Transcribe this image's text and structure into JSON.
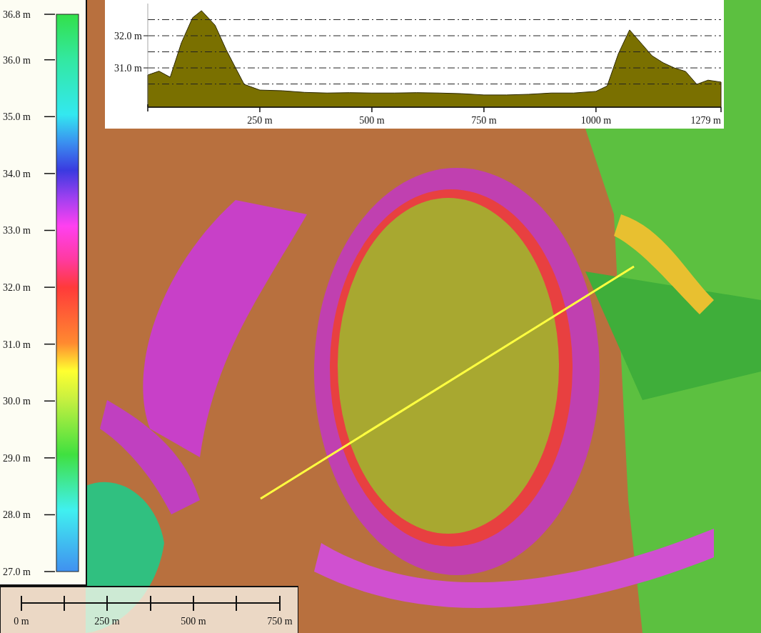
{
  "legend": {
    "labels": [
      "36.8 m",
      "36.0 m",
      "35.0 m",
      "34.0 m",
      "33.0 m",
      "32.0 m",
      "31.0 m",
      "30.0 m",
      "29.0 m",
      "28.0 m",
      "27.0 m"
    ]
  },
  "profile": {
    "chart_data": {
      "type": "area",
      "x": [
        0,
        25,
        50,
        75,
        100,
        120,
        150,
        175,
        200,
        215,
        250,
        300,
        350,
        400,
        450,
        500,
        550,
        600,
        650,
        700,
        750,
        800,
        850,
        900,
        950,
        1000,
        1025,
        1050,
        1075,
        1100,
        1125,
        1150,
        1175,
        1200,
        1225,
        1250,
        1279
      ],
      "series": [
        {
          "color": "#7a7000",
          "values": [
            30.78,
            30.9,
            30.71,
            31.78,
            32.56,
            32.78,
            32.33,
            31.56,
            30.89,
            30.49,
            30.31,
            30.29,
            30.24,
            30.22,
            30.23,
            30.22,
            30.22,
            30.23,
            30.22,
            30.2,
            30.16,
            30.16,
            30.18,
            30.22,
            30.22,
            30.27,
            30.44,
            31.44,
            32.18,
            31.78,
            31.38,
            31.16,
            31.0,
            30.89,
            30.49,
            30.62,
            30.56
          ]
        }
      ],
      "xlim": [
        0,
        1279
      ],
      "ylim": [
        29.78,
        33.0
      ],
      "xticks": [
        {
          "value": 250,
          "label": "250 m"
        },
        {
          "value": 500,
          "label": "500 m"
        },
        {
          "value": 750,
          "label": "750 m"
        },
        {
          "value": 1000,
          "label": "1000 m"
        },
        {
          "value": 1279,
          "label": "1279 m"
        }
      ],
      "yticks": [
        {
          "value": 31.0,
          "label": "31.0 m"
        },
        {
          "value": 32.0,
          "label": "32.0 m"
        }
      ]
    }
  },
  "scale_bar": {
    "labels": [
      "0 m",
      "250 m",
      "500 m",
      "750 m"
    ]
  }
}
